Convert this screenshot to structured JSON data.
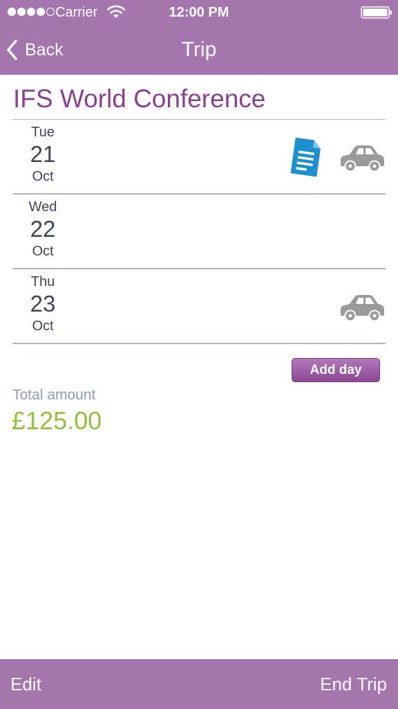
{
  "status_bar": {
    "carrier": "Carrier",
    "time": "12:00 PM",
    "signal_bars": 4,
    "signal_max": 5,
    "icons": [
      "signal-dots-icon",
      "wifi-icon",
      "battery-icon"
    ]
  },
  "nav": {
    "back_label": "Back",
    "title": "Trip",
    "back_icon": "chevron-left-icon"
  },
  "trip": {
    "title": "IFS World Conference",
    "days": [
      {
        "weekday": "Tue",
        "day": "21",
        "month": "Oct",
        "icons": [
          "document-icon",
          "car-icon"
        ]
      },
      {
        "weekday": "Wed",
        "day": "22",
        "month": "Oct",
        "icons": []
      },
      {
        "weekday": "Thu",
        "day": "23",
        "month": "Oct",
        "icons": [
          "car-icon"
        ]
      }
    ],
    "add_day_label": "Add day",
    "total_label": "Total amount",
    "total_value": "£125.00"
  },
  "toolbar": {
    "edit_label": "Edit",
    "end_trip_label": "End Trip"
  },
  "colors": {
    "bar_background": "#a576ad",
    "title_text": "#8b3f93",
    "date_text": "#3e4358",
    "row_divider": "#aab4cc",
    "total_label": "#8e9cbc",
    "total_value": "#93c13d",
    "document_icon": "#1e8fd0",
    "car_icon": "#9a9a9a"
  }
}
